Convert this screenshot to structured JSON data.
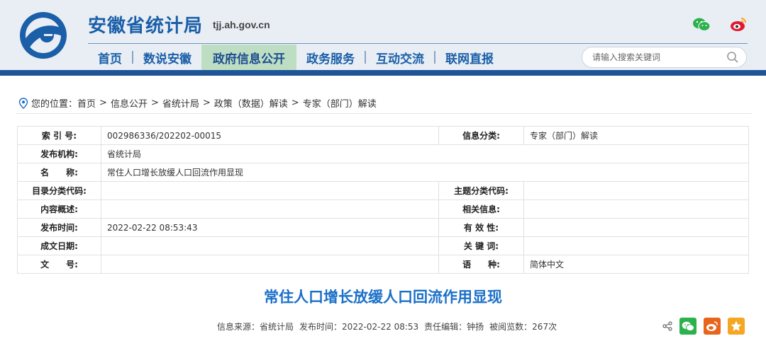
{
  "header": {
    "site_title": "安徽省统计局",
    "site_domain": "tjj.ah.gov.cn",
    "nav": [
      {
        "label": "首页",
        "active": false
      },
      {
        "label": "数说安徽",
        "active": false
      },
      {
        "label": "政府信息公开",
        "active": true
      },
      {
        "label": "政务服务",
        "active": false
      },
      {
        "label": "互动交流",
        "active": false
      },
      {
        "label": "联网直报",
        "active": false
      }
    ],
    "search_placeholder": "请输入搜索关键词",
    "icons": [
      "wechat-icon",
      "weibo-icon",
      "search-icon"
    ],
    "colors": {
      "brand": "#1a5fa8",
      "header_bg": "#e9eef5",
      "active_tab": "#bedec3",
      "bar": "#1f5597"
    }
  },
  "breadcrumb": {
    "prefix": "您的位置：",
    "items": [
      "首页",
      "信息公开",
      "省统计局",
      "政策（数据）解读",
      "专家（部门）解读"
    ],
    "separator": ">"
  },
  "info": {
    "index_label": "索 引 号:",
    "index_value": "002986336/202202-00015",
    "category_label": "信息分类:",
    "category_value": "专家（部门）解读",
    "publisher_label": "发布机构:",
    "publisher_value": "省统计局",
    "name_label": "名　　称:",
    "name_value": "常住人口增长放缓人口回流作用显现",
    "catalog_label": "目录分类代码:",
    "catalog_value": "",
    "topic_label": "主题分类代码:",
    "topic_value": "",
    "summary_label": "内容概述:",
    "summary_value": "",
    "related_label": "相关信息:",
    "related_value": "",
    "time_label": "发布时间:",
    "time_value": "2022-02-22 08:53:43",
    "validity_label": "有 效 性:",
    "validity_value": "",
    "date_label": "成文日期:",
    "date_value": "",
    "keyword_label": "关 键 词:",
    "keyword_value": "",
    "docno_label": "文　　号:",
    "docno_value": "",
    "lang_label": "语　　种:",
    "lang_value": "简体中文"
  },
  "article": {
    "title": "常住人口增长放缓人口回流作用显现",
    "source": "信息来源：省统计局",
    "publish_time": "发布时间：2022-02-22 08:53",
    "editor": "责任编辑：钟扬",
    "views": "被阅览数：267次"
  },
  "share": {
    "icons": [
      "share-icon",
      "wechat-share-icon",
      "weibo-share-icon",
      "qzone-share-icon"
    ],
    "colors": {
      "wechat": "#2bb24c",
      "weibo": "#e8641b",
      "qzone": "#f5a623"
    }
  }
}
